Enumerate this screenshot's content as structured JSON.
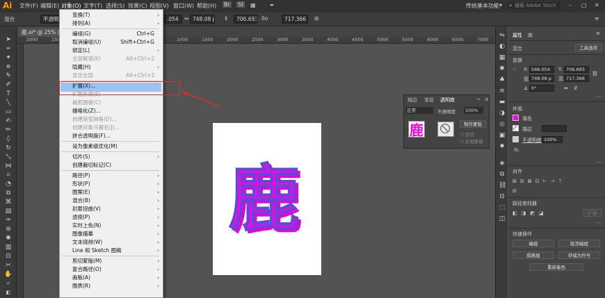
{
  "app": {
    "logo": "Ai",
    "workspace": "传统基本功能",
    "search_placeholder": "搜索 Adobe Stock"
  },
  "menubar": [
    "文件(F)",
    "编辑(E)",
    "对象(O)",
    "文字(T)",
    "选择(S)",
    "效果(C)",
    "视图(V)",
    "窗口(W)",
    "帮助(H)"
  ],
  "control_bar": {
    "selection_label": "混合",
    "fill_placeholder": "不透明度",
    "x": ".054",
    "w": "748.08 p",
    "h_icon": "⇕",
    "y": "706.693",
    "link": "ōο",
    "h": "717.366"
  },
  "document": {
    "tab": "鹿.ai* @ 25% (RG",
    "ruler": [
      "2000",
      "1500",
      "1000",
      "500",
      "0",
      "500",
      "1000",
      "1500",
      "2000",
      "2500",
      "3000",
      "3500",
      "4000",
      "4500",
      "5000",
      "5500",
      "6000",
      "6500",
      "7000"
    ]
  },
  "artwork": {
    "glyph": "鹿",
    "fill_color": "#ff00e6",
    "stroke_color": "#5b4bd6"
  },
  "object_menu": {
    "items": [
      {
        "label": "变换(T)",
        "arrow": true
      },
      {
        "label": "排列(A)",
        "arrow": true
      },
      {
        "sep": true
      },
      {
        "label": "编组(G)",
        "shortcut": "Ctrl+G"
      },
      {
        "label": "取消编组(U)",
        "shortcut": "Shift+Ctrl+G"
      },
      {
        "label": "锁定(L)",
        "arrow": true
      },
      {
        "label": "全部解锁(K)",
        "shortcut": "Alt+Ctrl+2",
        "disabled": true
      },
      {
        "label": "隐藏(H)",
        "arrow": true
      },
      {
        "label": "显示全部",
        "shortcut": "Alt+Ctrl+3",
        "disabled": true
      },
      {
        "sep": true
      },
      {
        "label": "扩展(X)...",
        "highlight": true
      },
      {
        "label": "扩展外观(E)",
        "disabled": true
      },
      {
        "label": "裁剪图像(C)",
        "disabled": true
      },
      {
        "label": "栅格化(Z)..."
      },
      {
        "label": "创建渐变网格(D)...",
        "disabled": true
      },
      {
        "label": "创建对象马赛克(J)...",
        "disabled": true
      },
      {
        "label": "拼合透明度(F)..."
      },
      {
        "sep": true
      },
      {
        "label": "设为像素级优化(M)"
      },
      {
        "sep": true
      },
      {
        "label": "切片(S)",
        "arrow": true
      },
      {
        "label": "创建裁切标记(C)"
      },
      {
        "sep": true
      },
      {
        "label": "路径(P)",
        "arrow": true
      },
      {
        "label": "形状(P)",
        "arrow": true
      },
      {
        "label": "图案(E)",
        "arrow": true
      },
      {
        "label": "混合(B)",
        "arrow": true
      },
      {
        "label": "封套扭曲(V)",
        "arrow": true
      },
      {
        "label": "透视(P)",
        "arrow": true
      },
      {
        "label": "实时上色(N)",
        "arrow": true
      },
      {
        "label": "图像描摹",
        "arrow": true
      },
      {
        "label": "文本绕排(W)",
        "arrow": true
      },
      {
        "label": "Line 和 Sketch 图稿",
        "arrow": true
      },
      {
        "sep": true
      },
      {
        "label": "剪切蒙版(M)",
        "arrow": true
      },
      {
        "label": "复合路径(O)",
        "arrow": true
      },
      {
        "label": "画板(A)",
        "arrow": true
      },
      {
        "label": "图表(R)",
        "arrow": true
      }
    ]
  },
  "transparency_panel": {
    "tabs": [
      "描边",
      "渐变",
      "透明度"
    ],
    "blend_mode": "正常",
    "opacity_label": "不透明度",
    "opacity": "100%",
    "make_mask": "制作蒙版",
    "clip": "剪切",
    "invert_mask": "反相蒙版"
  },
  "properties_panel": {
    "tabs": [
      "属性",
      "库"
    ],
    "selection": "混合",
    "quick_button": "工具选项",
    "transform_title": "变换",
    "x_label": "X:",
    "x": "546.054",
    "y_label": "Y:",
    "y": "706.693",
    "w_label": "宽:",
    "w": "748.08 p",
    "h_label": "高:",
    "h": "717.366",
    "angle": "0°",
    "appearance_title": "外观",
    "fill_label": "填色",
    "stroke_label": "描边",
    "opacity_label": "不透明度",
    "opacity": "100%",
    "fx": "fx.",
    "align_title": "对齐",
    "pathfinder_title": "路径查找器",
    "expand_btn": "扩展",
    "quick_actions_title": "快速操作",
    "btn_group": "编组",
    "btn_ungroup": "取消编组",
    "btn_isolate": "隔离组",
    "btn_save_symbol": "存储为符号",
    "btn_recolor": "重新着色"
  },
  "colors": {
    "fill": "#ff00e6",
    "highlight": "#9bc3ef",
    "annotation": "#e0302a"
  }
}
